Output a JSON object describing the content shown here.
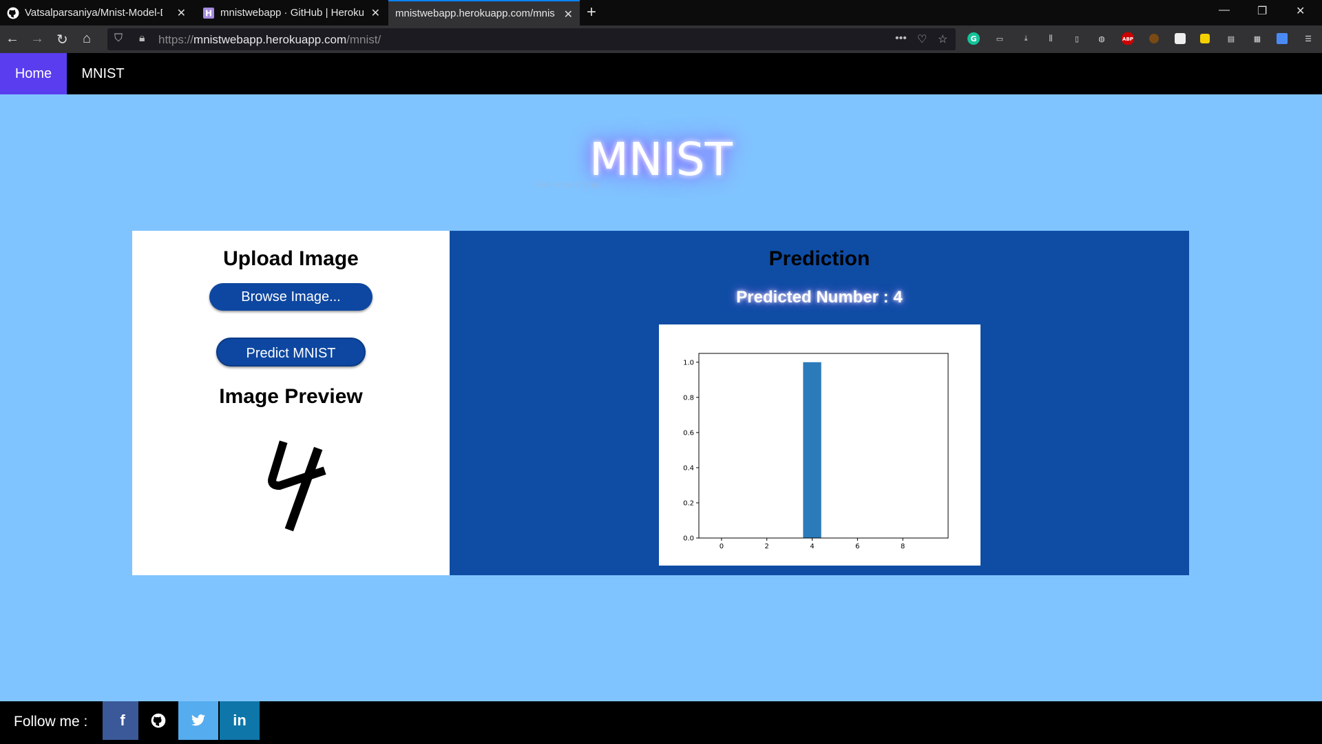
{
  "browser": {
    "tabs": [
      {
        "title": "Vatsalparsaniya/Mnist-Model-D",
        "icon": "github-icon"
      },
      {
        "title": "mnistwebapp · GitHub | Heroku",
        "icon": "heroku-icon"
      },
      {
        "title": "mnistwebapp.herokuapp.com/mnis",
        "icon": "none"
      }
    ],
    "url_scheme": "https://",
    "url_host": "mnistwebapp.herokuapp.com",
    "url_path": "/mnist/"
  },
  "nav": {
    "home": "Home",
    "mnist": "MNIST"
  },
  "page": {
    "title": "MNIST",
    "overlay": "Full-screen Snip"
  },
  "upload": {
    "heading": "Upload Image",
    "browse_label": "Browse Image...",
    "predict_label": "Predict MNIST",
    "preview_heading": "Image Preview",
    "preview_digit": "4"
  },
  "prediction": {
    "heading": "Prediction",
    "text": "Predicted Number : 4"
  },
  "footer": {
    "follow_label": "Follow me :",
    "social": [
      {
        "name": "facebook",
        "glyph": "f",
        "color": "#3b5998"
      },
      {
        "name": "github",
        "glyph": "",
        "color": "#000000"
      },
      {
        "name": "twitter",
        "glyph": "",
        "color": "#55acee"
      },
      {
        "name": "linkedin",
        "glyph": "in",
        "color": "#0e76a8"
      }
    ]
  },
  "chart_data": {
    "type": "bar",
    "categories": [
      0,
      1,
      2,
      3,
      4,
      5,
      6,
      7,
      8,
      9
    ],
    "values": [
      0,
      0,
      0,
      0,
      1.0,
      0,
      0,
      0,
      0,
      0
    ],
    "xticks": [
      0,
      2,
      4,
      6,
      8
    ],
    "yticks": [
      0.0,
      0.2,
      0.4,
      0.6,
      0.8,
      1.0
    ],
    "ylim": [
      0,
      1.05
    ],
    "xlim": [
      -1,
      10
    ],
    "bar_color": "#2b7bba"
  }
}
